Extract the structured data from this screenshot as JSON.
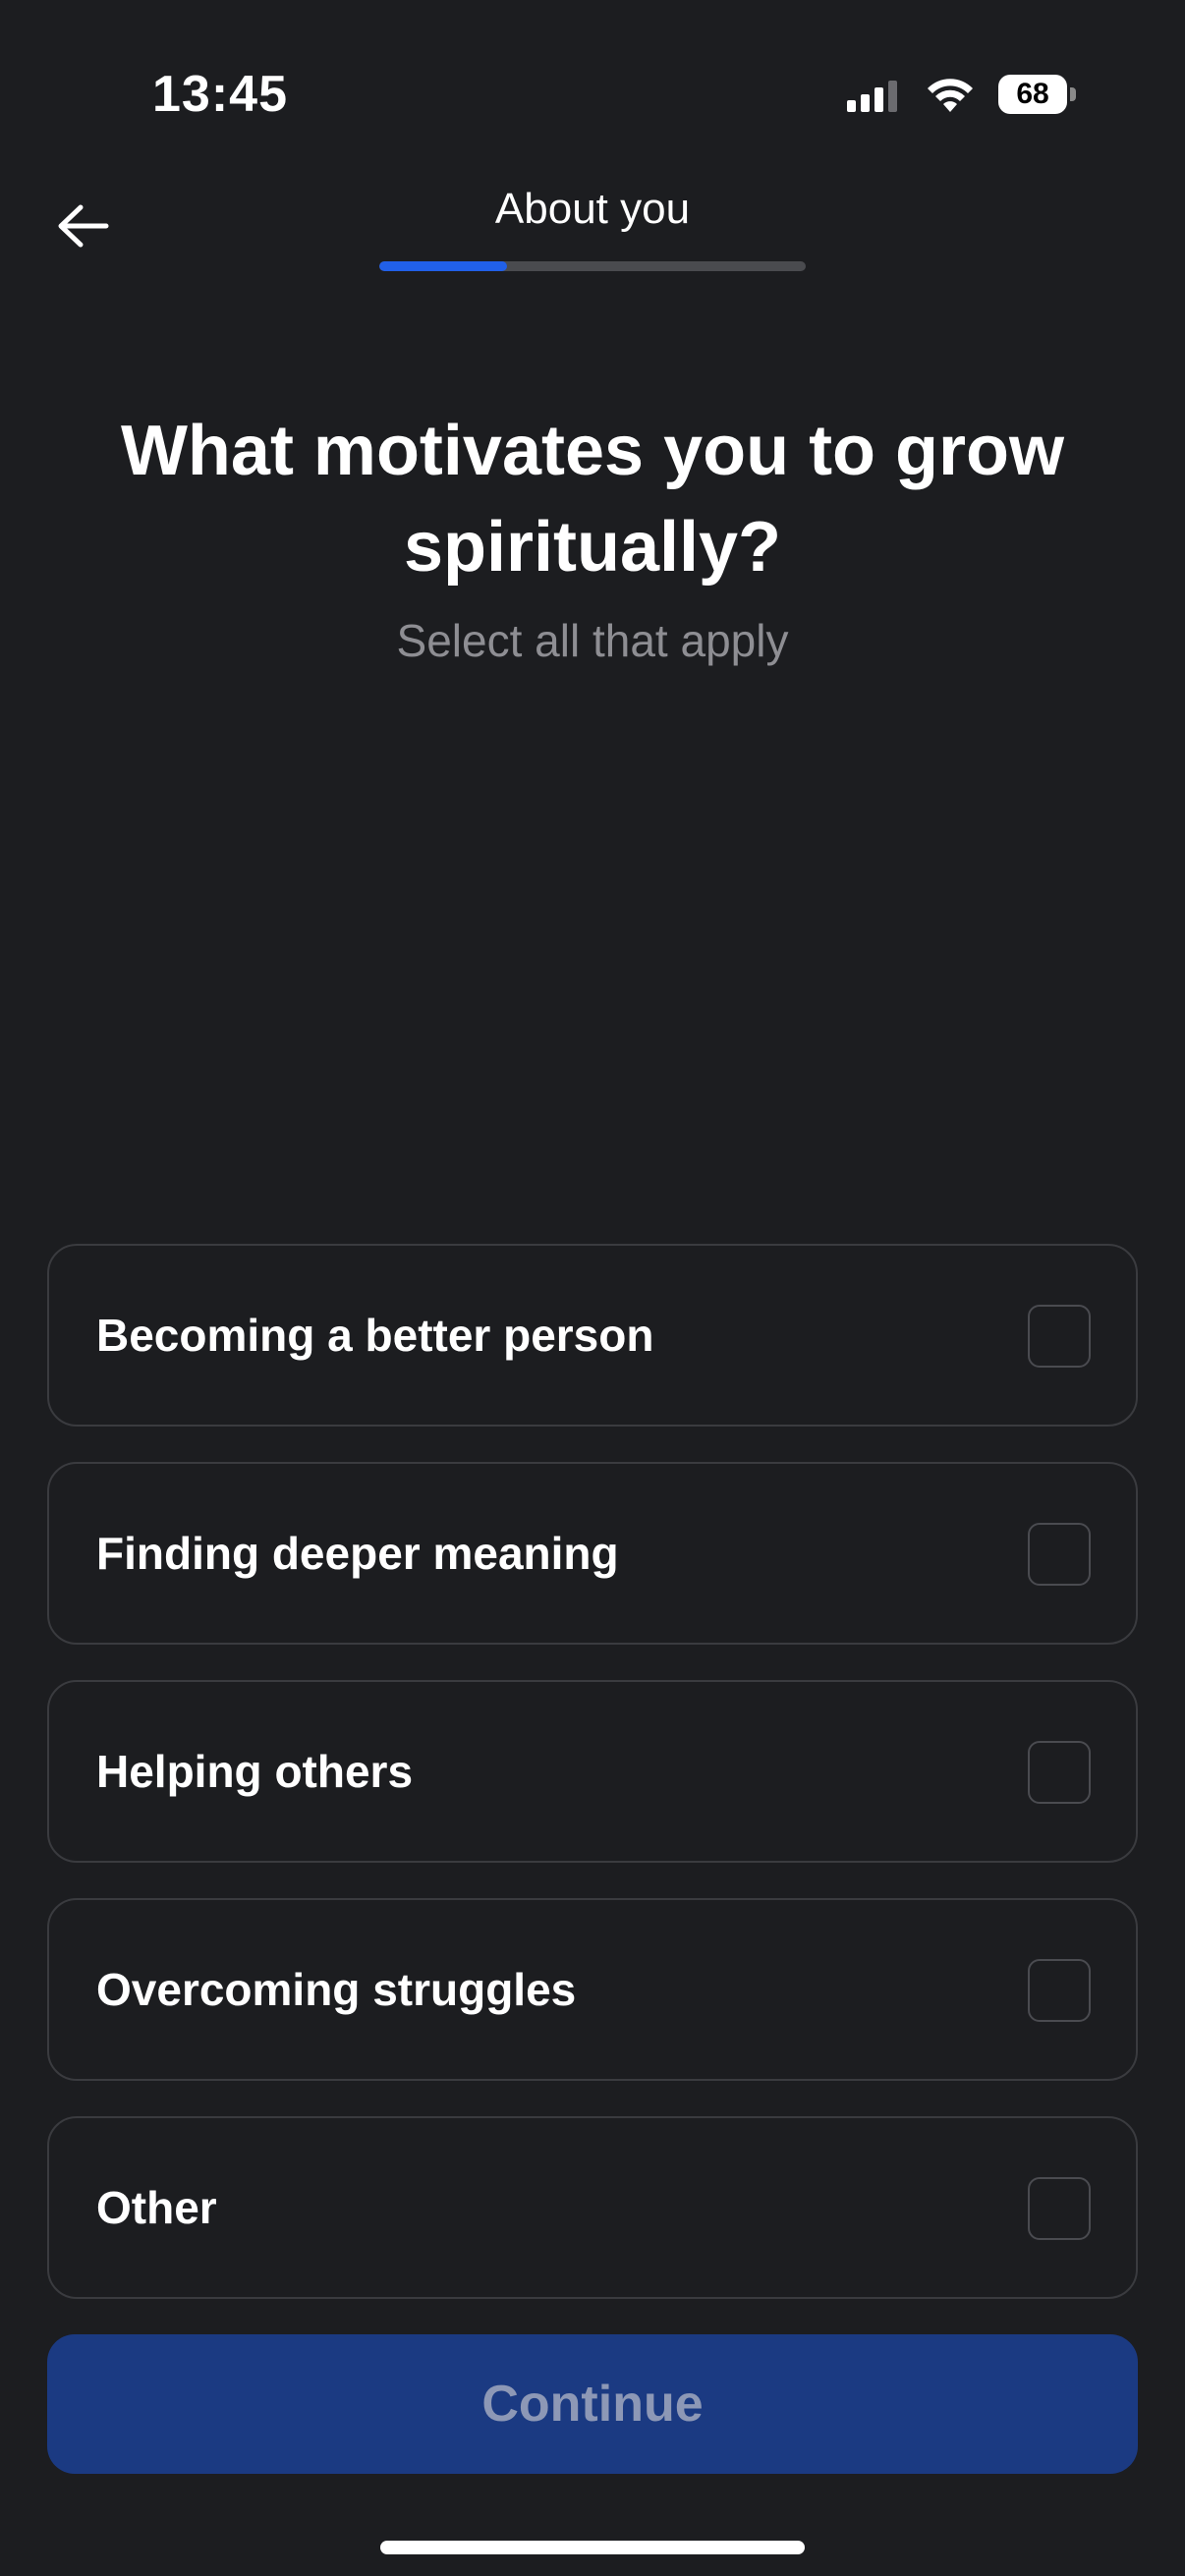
{
  "status_bar": {
    "time": "13:45",
    "battery": "68",
    "icons": [
      "signal-icon",
      "wifi-icon",
      "battery-icon"
    ]
  },
  "nav": {
    "title": "About you",
    "back_icon": "arrow-left-icon",
    "progress_fraction": 0.3
  },
  "question": {
    "title": "What motivates you to grow spiritually?",
    "subtitle": "Select all that apply"
  },
  "options": [
    {
      "label": "Becoming a better person",
      "checked": false
    },
    {
      "label": "Finding deeper meaning",
      "checked": false
    },
    {
      "label": "Helping others",
      "checked": false
    },
    {
      "label": "Overcoming struggles",
      "checked": false
    },
    {
      "label": "Other",
      "checked": false
    }
  ],
  "continue_label": "Continue",
  "colors": {
    "background": "#1c1d20",
    "accent": "#2160e8",
    "button": "#1b3a82",
    "button_text": "#8d98b6"
  }
}
